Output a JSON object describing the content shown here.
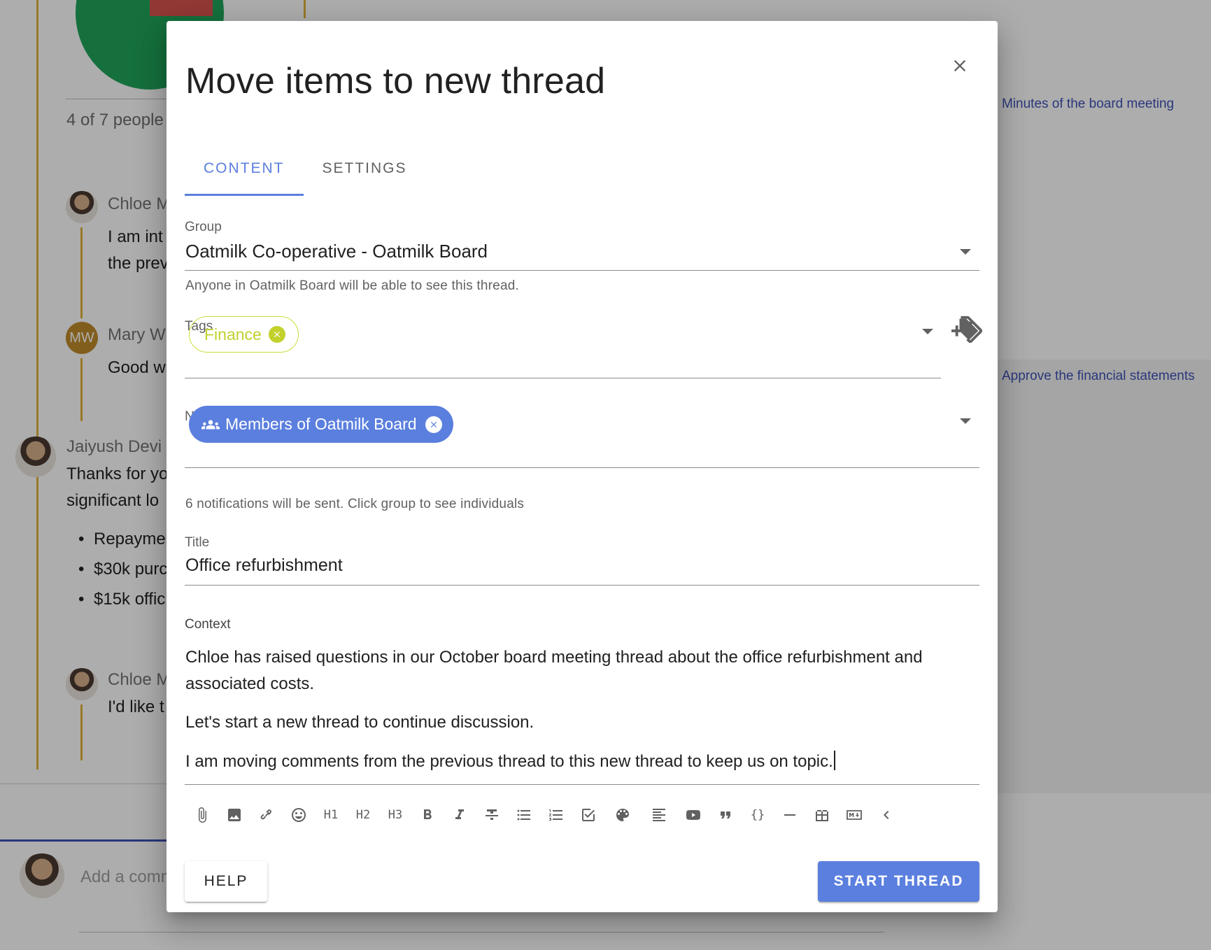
{
  "background": {
    "people_count": "4 of 7 people",
    "comments": [
      {
        "name": "Chloe M",
        "text_lines": [
          "I am int",
          "the prev"
        ]
      },
      {
        "name": "Mary W",
        "initials": "MW",
        "text_lines": [
          "Good w"
        ]
      },
      {
        "name": "Jaiyush Devi",
        "text_lines": [
          "Thanks for yo",
          "significant lo"
        ]
      },
      {
        "name": "Chloe M",
        "text_lines": [
          "I'd like t"
        ]
      }
    ],
    "bullets": [
      "Repayme",
      "$30k purc",
      "$15k offic"
    ],
    "right_links": [
      "Minutes of the board meeting",
      "Approve the financial statements"
    ],
    "add_comment_placeholder": "Add a comm"
  },
  "dialog": {
    "title": "Move items to new thread",
    "tabs": [
      {
        "label": "CONTENT",
        "active": true
      },
      {
        "label": "SETTINGS",
        "active": false
      }
    ],
    "group": {
      "label": "Group",
      "value": "Oatmilk Co-operative - Oatmilk Board",
      "hint": "Anyone in Oatmilk Board will be able to see this thread."
    },
    "tags": {
      "label": "Tags",
      "chips": [
        {
          "label": "Finance",
          "color": "#c2d12c"
        }
      ]
    },
    "notify": {
      "label": "Notify",
      "chips": [
        {
          "label": "Members of Oatmilk Board",
          "icon": "group-icon",
          "color": "#5b7fde"
        }
      ],
      "hint": "6 notifications will be sent. Click group to see individuals"
    },
    "title_field": {
      "label": "Title",
      "value": "Office refurbishment"
    },
    "context": {
      "label": "Context",
      "paragraphs": [
        "Chloe has raised questions in our October board meeting thread about the office refurbishment and associated costs.",
        "Let's start a new thread to continue discussion.",
        "I am moving comments from the previous thread to this new thread to keep us on topic."
      ]
    },
    "toolbar": {
      "h1": "H1",
      "h2": "H2",
      "h3": "H3",
      "code": "{}"
    },
    "buttons": {
      "help": "HELP",
      "start_thread": "START THREAD"
    },
    "accent_color": "#5b7fde"
  }
}
